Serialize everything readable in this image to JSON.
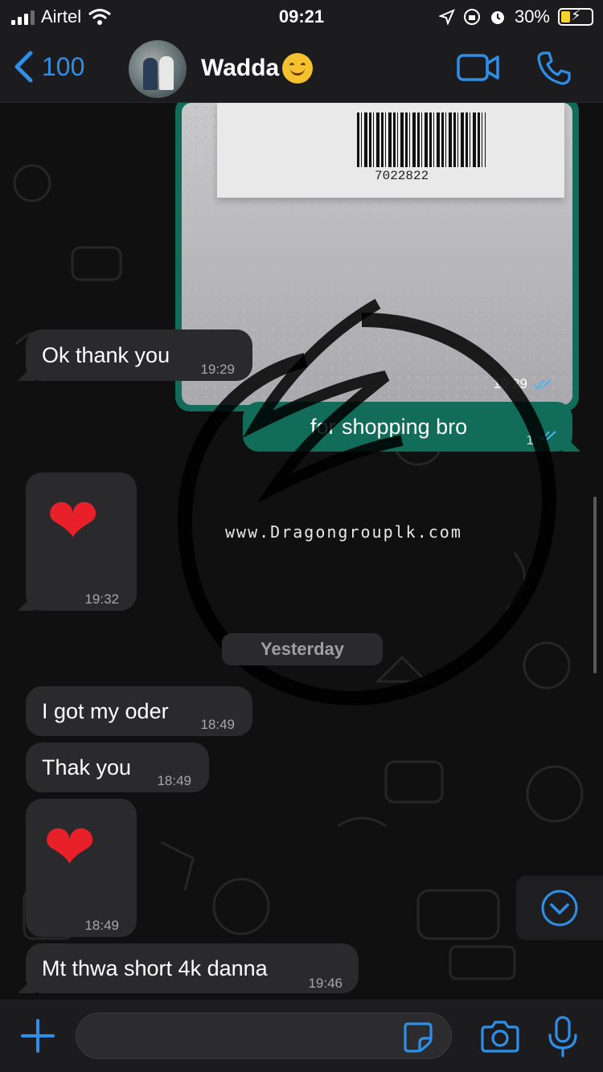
{
  "status_bar": {
    "carrier": "Airtel",
    "time": "09:21",
    "battery_percent": "30%",
    "battery_level": 0.3
  },
  "header": {
    "back_count": "100",
    "contact_name": "Wadda",
    "name_emoji": "smiling-face"
  },
  "messages": [
    {
      "type": "image",
      "direction": "out",
      "barcode_number": "7022822",
      "time": "19:29",
      "status": "read"
    },
    {
      "type": "text",
      "direction": "in",
      "text": "Ok thank you",
      "time": "19:29"
    },
    {
      "type": "text",
      "direction": "out",
      "text": "for shopping bro",
      "time": "1",
      "status": "read"
    },
    {
      "type": "emoji",
      "direction": "in",
      "emoji": "❤",
      "time": "19:32"
    },
    {
      "type": "date",
      "label": "Yesterday"
    },
    {
      "type": "text",
      "direction": "in",
      "text": "I got my oder",
      "time": "18:49"
    },
    {
      "type": "text",
      "direction": "in",
      "text": "Thak you",
      "time": "18:49"
    },
    {
      "type": "emoji",
      "direction": "in",
      "emoji": "❤",
      "time": "18:49"
    },
    {
      "type": "text",
      "direction": "in",
      "text": "Mt thwa short 4k danna",
      "time": "19:46"
    }
  ],
  "watermark": {
    "text": "www.Dragongrouplk.com"
  },
  "composer": {
    "value": "",
    "placeholder": ""
  },
  "colors": {
    "accent": "#2f8fe8",
    "outgoing_bubble": "#116d5a",
    "incoming_bubble": "#2a2a2c",
    "background": "#101010"
  }
}
